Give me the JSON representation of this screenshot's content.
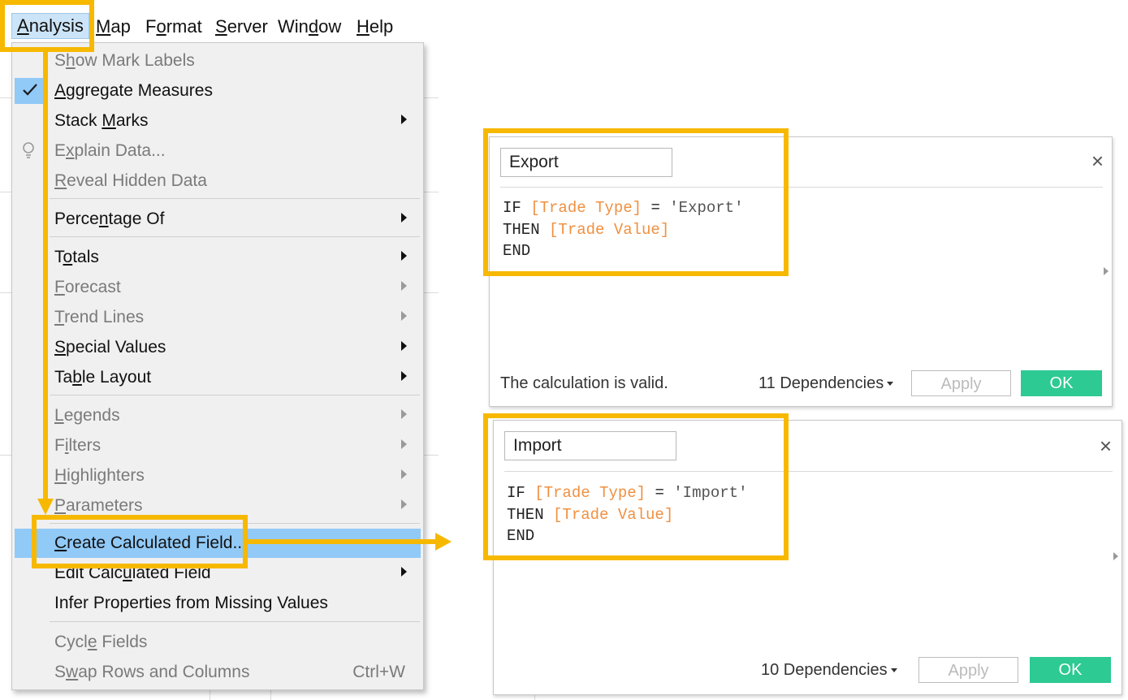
{
  "menubar": {
    "items": [
      {
        "label": "Analysis",
        "key": "A",
        "rest": "nalysis"
      },
      {
        "label": "Map",
        "key": "M",
        "rest": "ap"
      },
      {
        "label": "Format",
        "pre": "F",
        "key": "o",
        "rest": "rmat"
      },
      {
        "label": "Server",
        "key": "S",
        "rest": "erver"
      },
      {
        "label": "Window",
        "pre": "Win",
        "key": "d",
        "rest": "ow"
      },
      {
        "label": "Help",
        "key": "H",
        "rest": "elp"
      }
    ]
  },
  "menu": {
    "show_mark_labels": {
      "pre": "S",
      "key": "h",
      "rest": "ow Mark Labels"
    },
    "aggregate_measures": {
      "pre": "",
      "key": "A",
      "rest": "ggregate Measures"
    },
    "stack_marks": {
      "pre": "Stack ",
      "key": "M",
      "rest": "arks"
    },
    "explain_data": {
      "pre": "E",
      "key": "x",
      "rest": "plain Data..."
    },
    "reveal_hidden_data": {
      "pre": "",
      "key": "R",
      "rest": "eveal Hidden Data"
    },
    "percentage_of": {
      "pre": "Perce",
      "key": "n",
      "rest": "tage Of"
    },
    "totals": {
      "pre": "T",
      "key": "o",
      "rest": "tals"
    },
    "forecast": {
      "pre": "",
      "key": "F",
      "rest": "orecast"
    },
    "trend_lines": {
      "pre": "",
      "key": "T",
      "rest": "rend Lines"
    },
    "special_values": {
      "pre": "",
      "key": "S",
      "rest": "pecial Values"
    },
    "table_layout": {
      "pre": "Ta",
      "key": "b",
      "rest": "le Layout"
    },
    "legends": {
      "pre": "",
      "key": "L",
      "rest": "egends"
    },
    "filters": {
      "pre": "F",
      "key": "i",
      "rest": "lters"
    },
    "highlighters": {
      "pre": "",
      "key": "H",
      "rest": "ighlighters"
    },
    "parameters": {
      "pre": "",
      "key": "P",
      "rest": "arameters"
    },
    "create_calculated_field": {
      "pre": "",
      "key": "C",
      "rest": "reate Calculated Field..."
    },
    "edit_calculated_field": {
      "pre": "Edit Calc",
      "key": "u",
      "rest": "lated Field"
    },
    "infer_properties": {
      "label": "Infer Properties from Missing Values"
    },
    "cycle_fields": {
      "pre": "Cycl",
      "key": "e",
      "rest": " Fields"
    },
    "swap_rows_columns": {
      "pre": "S",
      "key": "w",
      "rest": "ap Rows and Columns",
      "shortcut": "Ctrl+W"
    }
  },
  "dialog_export": {
    "name": "Export",
    "code": {
      "kw_if": "IF ",
      "field1": "[Trade Type]",
      "op": " = ",
      "literal": "'Export'",
      "kw_then": "THEN ",
      "field2": "[Trade Value]",
      "kw_end": "END"
    },
    "status": "The calculation is valid.",
    "dependencies": "11 Dependencies",
    "apply": "Apply",
    "ok": "OK",
    "close": "×"
  },
  "dialog_import": {
    "name": "Import",
    "code": {
      "kw_if": "IF ",
      "field1": "[Trade Type]",
      "op": " = ",
      "literal": "'Import'",
      "kw_then": "THEN ",
      "field2": "[Trade Value]",
      "kw_end": "END"
    },
    "dependencies": "10 Dependencies",
    "apply": "Apply",
    "ok": "OK",
    "close": "×"
  },
  "colors": {
    "highlight": "#f7b800",
    "menu_selected": "#91c9f7",
    "ok_button": "#2dca93",
    "field_orange": "#f09040"
  }
}
